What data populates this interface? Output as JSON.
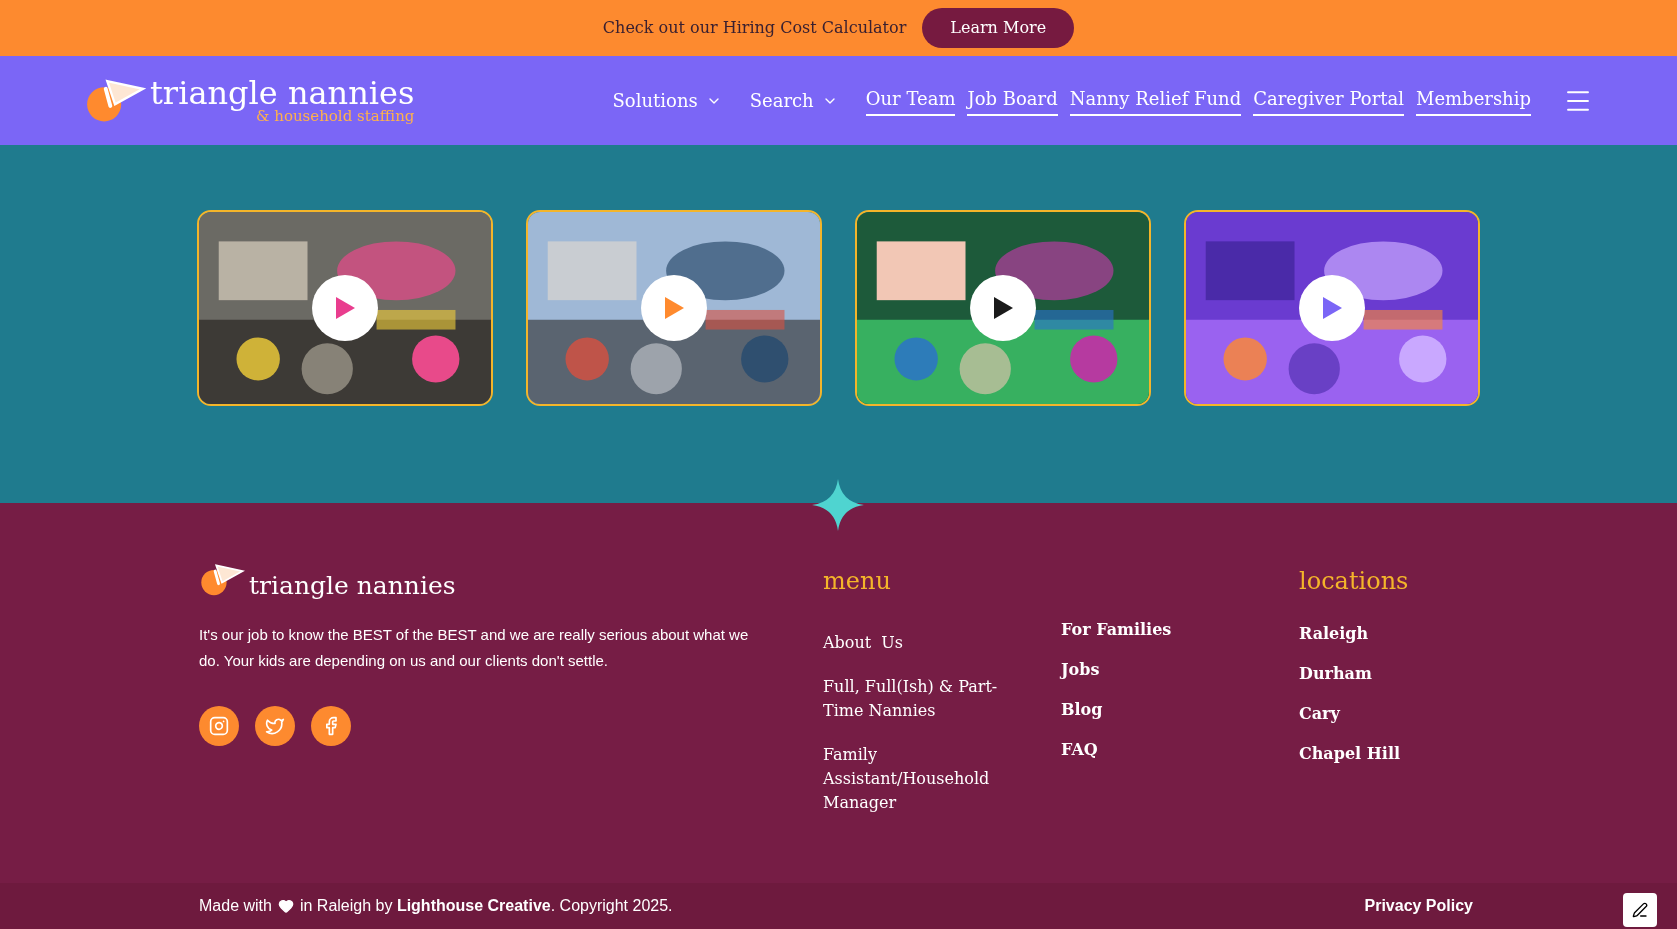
{
  "announcement": {
    "text": "Check out our Hiring Cost Calculator",
    "button": "Learn More"
  },
  "header": {
    "logo": {
      "name": "triangle nannies",
      "tagline": "& household staffing"
    },
    "nav": [
      {
        "label": "Solutions",
        "kind": "dropdown"
      },
      {
        "label": "Search",
        "kind": "dropdown"
      },
      {
        "label": "Our Team",
        "kind": "link"
      },
      {
        "label": "Job Board",
        "kind": "link"
      },
      {
        "label": "Nanny Relief Fund",
        "kind": "link"
      },
      {
        "label": "Caregiver Portal",
        "kind": "link"
      },
      {
        "label": "Membership",
        "kind": "link"
      }
    ]
  },
  "footer": {
    "logo": "triangle nannies",
    "about": "It's our job to know the BEST of the BEST and we are really serious about what we do. Your kids are depending on us and our clients don't settle.",
    "menu_title": "menu",
    "menu_column_1": [
      "About  Us",
      "Full, Full(Ish) & Part-Time Nannies",
      "Family Assistant/Household Manager"
    ],
    "menu_column_2": [
      "For Families",
      "Jobs",
      "Blog",
      "FAQ"
    ],
    "locations_title": "locations",
    "locations": [
      "Raleigh",
      "Durham",
      "Cary",
      "Chapel Hill"
    ],
    "bottom": {
      "made_with": "Made with",
      "credit": "in Raleigh by **Lighthouse Creative**. Copyright 2025.",
      "privacy": "Privacy Policy"
    }
  }
}
